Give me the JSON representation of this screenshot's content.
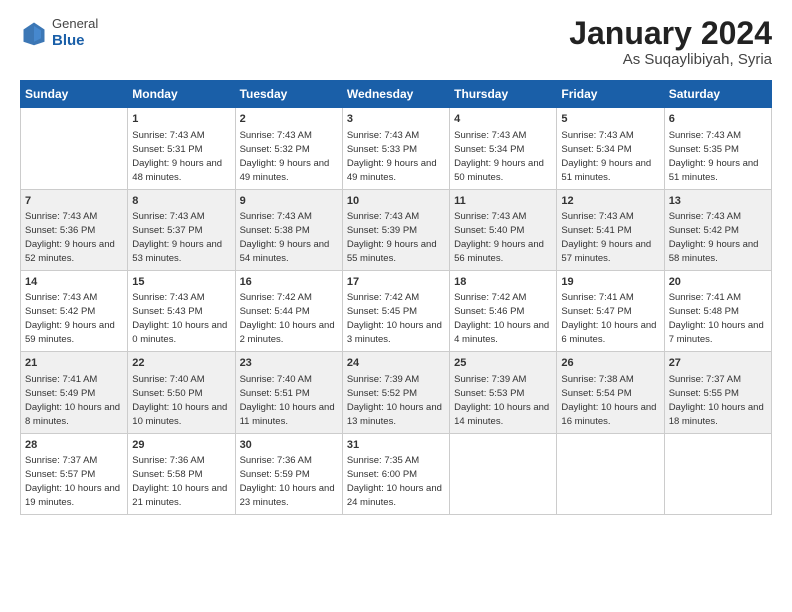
{
  "header": {
    "logo_general": "General",
    "logo_blue": "Blue",
    "title": "January 2024",
    "subtitle": "As Suqaylibiyah, Syria"
  },
  "columns": [
    "Sunday",
    "Monday",
    "Tuesday",
    "Wednesday",
    "Thursday",
    "Friday",
    "Saturday"
  ],
  "weeks": [
    [
      {
        "day": "",
        "sunrise": "",
        "sunset": "",
        "daylight": ""
      },
      {
        "day": "1",
        "sunrise": "Sunrise: 7:43 AM",
        "sunset": "Sunset: 5:31 PM",
        "daylight": "Daylight: 9 hours and 48 minutes."
      },
      {
        "day": "2",
        "sunrise": "Sunrise: 7:43 AM",
        "sunset": "Sunset: 5:32 PM",
        "daylight": "Daylight: 9 hours and 49 minutes."
      },
      {
        "day": "3",
        "sunrise": "Sunrise: 7:43 AM",
        "sunset": "Sunset: 5:33 PM",
        "daylight": "Daylight: 9 hours and 49 minutes."
      },
      {
        "day": "4",
        "sunrise": "Sunrise: 7:43 AM",
        "sunset": "Sunset: 5:34 PM",
        "daylight": "Daylight: 9 hours and 50 minutes."
      },
      {
        "day": "5",
        "sunrise": "Sunrise: 7:43 AM",
        "sunset": "Sunset: 5:34 PM",
        "daylight": "Daylight: 9 hours and 51 minutes."
      },
      {
        "day": "6",
        "sunrise": "Sunrise: 7:43 AM",
        "sunset": "Sunset: 5:35 PM",
        "daylight": "Daylight: 9 hours and 51 minutes."
      }
    ],
    [
      {
        "day": "7",
        "sunrise": "Sunrise: 7:43 AM",
        "sunset": "Sunset: 5:36 PM",
        "daylight": "Daylight: 9 hours and 52 minutes."
      },
      {
        "day": "8",
        "sunrise": "Sunrise: 7:43 AM",
        "sunset": "Sunset: 5:37 PM",
        "daylight": "Daylight: 9 hours and 53 minutes."
      },
      {
        "day": "9",
        "sunrise": "Sunrise: 7:43 AM",
        "sunset": "Sunset: 5:38 PM",
        "daylight": "Daylight: 9 hours and 54 minutes."
      },
      {
        "day": "10",
        "sunrise": "Sunrise: 7:43 AM",
        "sunset": "Sunset: 5:39 PM",
        "daylight": "Daylight: 9 hours and 55 minutes."
      },
      {
        "day": "11",
        "sunrise": "Sunrise: 7:43 AM",
        "sunset": "Sunset: 5:40 PM",
        "daylight": "Daylight: 9 hours and 56 minutes."
      },
      {
        "day": "12",
        "sunrise": "Sunrise: 7:43 AM",
        "sunset": "Sunset: 5:41 PM",
        "daylight": "Daylight: 9 hours and 57 minutes."
      },
      {
        "day": "13",
        "sunrise": "Sunrise: 7:43 AM",
        "sunset": "Sunset: 5:42 PM",
        "daylight": "Daylight: 9 hours and 58 minutes."
      }
    ],
    [
      {
        "day": "14",
        "sunrise": "Sunrise: 7:43 AM",
        "sunset": "Sunset: 5:42 PM",
        "daylight": "Daylight: 9 hours and 59 minutes."
      },
      {
        "day": "15",
        "sunrise": "Sunrise: 7:43 AM",
        "sunset": "Sunset: 5:43 PM",
        "daylight": "Daylight: 10 hours and 0 minutes."
      },
      {
        "day": "16",
        "sunrise": "Sunrise: 7:42 AM",
        "sunset": "Sunset: 5:44 PM",
        "daylight": "Daylight: 10 hours and 2 minutes."
      },
      {
        "day": "17",
        "sunrise": "Sunrise: 7:42 AM",
        "sunset": "Sunset: 5:45 PM",
        "daylight": "Daylight: 10 hours and 3 minutes."
      },
      {
        "day": "18",
        "sunrise": "Sunrise: 7:42 AM",
        "sunset": "Sunset: 5:46 PM",
        "daylight": "Daylight: 10 hours and 4 minutes."
      },
      {
        "day": "19",
        "sunrise": "Sunrise: 7:41 AM",
        "sunset": "Sunset: 5:47 PM",
        "daylight": "Daylight: 10 hours and 6 minutes."
      },
      {
        "day": "20",
        "sunrise": "Sunrise: 7:41 AM",
        "sunset": "Sunset: 5:48 PM",
        "daylight": "Daylight: 10 hours and 7 minutes."
      }
    ],
    [
      {
        "day": "21",
        "sunrise": "Sunrise: 7:41 AM",
        "sunset": "Sunset: 5:49 PM",
        "daylight": "Daylight: 10 hours and 8 minutes."
      },
      {
        "day": "22",
        "sunrise": "Sunrise: 7:40 AM",
        "sunset": "Sunset: 5:50 PM",
        "daylight": "Daylight: 10 hours and 10 minutes."
      },
      {
        "day": "23",
        "sunrise": "Sunrise: 7:40 AM",
        "sunset": "Sunset: 5:51 PM",
        "daylight": "Daylight: 10 hours and 11 minutes."
      },
      {
        "day": "24",
        "sunrise": "Sunrise: 7:39 AM",
        "sunset": "Sunset: 5:52 PM",
        "daylight": "Daylight: 10 hours and 13 minutes."
      },
      {
        "day": "25",
        "sunrise": "Sunrise: 7:39 AM",
        "sunset": "Sunset: 5:53 PM",
        "daylight": "Daylight: 10 hours and 14 minutes."
      },
      {
        "day": "26",
        "sunrise": "Sunrise: 7:38 AM",
        "sunset": "Sunset: 5:54 PM",
        "daylight": "Daylight: 10 hours and 16 minutes."
      },
      {
        "day": "27",
        "sunrise": "Sunrise: 7:37 AM",
        "sunset": "Sunset: 5:55 PM",
        "daylight": "Daylight: 10 hours and 18 minutes."
      }
    ],
    [
      {
        "day": "28",
        "sunrise": "Sunrise: 7:37 AM",
        "sunset": "Sunset: 5:57 PM",
        "daylight": "Daylight: 10 hours and 19 minutes."
      },
      {
        "day": "29",
        "sunrise": "Sunrise: 7:36 AM",
        "sunset": "Sunset: 5:58 PM",
        "daylight": "Daylight: 10 hours and 21 minutes."
      },
      {
        "day": "30",
        "sunrise": "Sunrise: 7:36 AM",
        "sunset": "Sunset: 5:59 PM",
        "daylight": "Daylight: 10 hours and 23 minutes."
      },
      {
        "day": "31",
        "sunrise": "Sunrise: 7:35 AM",
        "sunset": "Sunset: 6:00 PM",
        "daylight": "Daylight: 10 hours and 24 minutes."
      },
      {
        "day": "",
        "sunrise": "",
        "sunset": "",
        "daylight": ""
      },
      {
        "day": "",
        "sunrise": "",
        "sunset": "",
        "daylight": ""
      },
      {
        "day": "",
        "sunrise": "",
        "sunset": "",
        "daylight": ""
      }
    ]
  ]
}
